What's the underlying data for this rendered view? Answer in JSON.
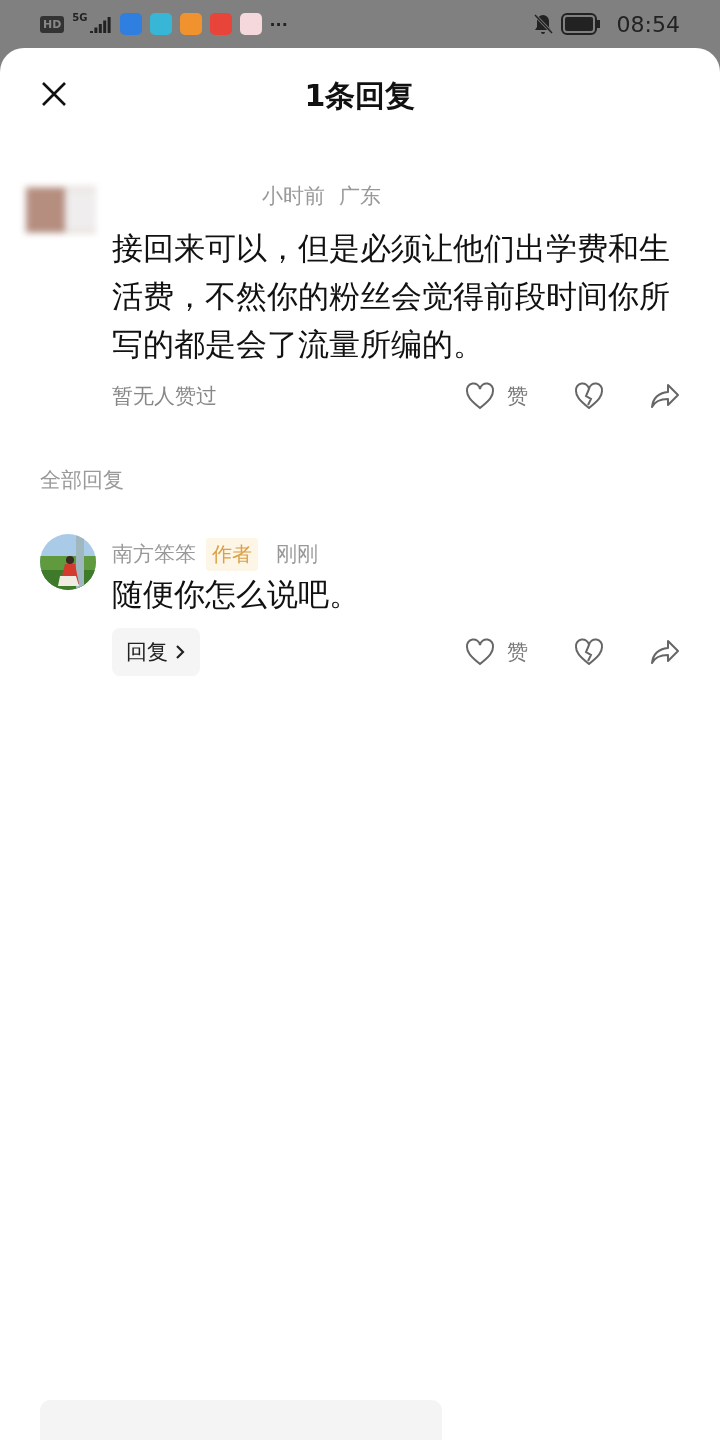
{
  "status_bar": {
    "hd": "HD",
    "network": "5G",
    "apps": [
      {
        "color": "#2f7fe0"
      },
      {
        "color": "#37b6d6"
      },
      {
        "color": "#f0922e"
      },
      {
        "color": "#e8443a"
      },
      {
        "color": "#f4d8dc"
      }
    ],
    "more": "···",
    "time": "08:54"
  },
  "sheet": {
    "title": "1条回复"
  },
  "comment": {
    "time": "小时前",
    "location": "广东",
    "text": "接回来可以，但是必须让他们出学费和生活费，不然你的粉丝会觉得前段时间你所写的都是会了流量所编的。",
    "likes_summary": "暂无人赞过",
    "like_label": "赞",
    "liked": false
  },
  "replies_heading": "全部回复",
  "replies": [
    {
      "author": "南方笨笨",
      "badge": "作者",
      "time": "刚刚",
      "text": "随便你怎么说吧。",
      "reply_button": "回复",
      "like_label": "赞",
      "liked": false
    }
  ]
}
